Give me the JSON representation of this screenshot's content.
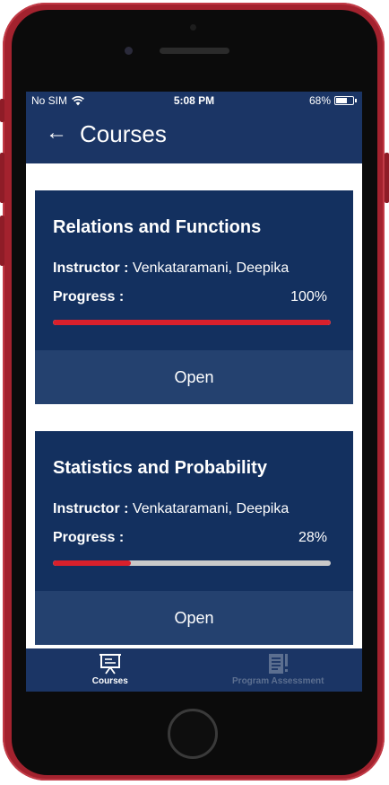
{
  "status_bar": {
    "carrier": "No SIM",
    "time": "5:08 PM",
    "battery": "68%",
    "battery_level": 0.68
  },
  "header": {
    "title": "Courses"
  },
  "courses": [
    {
      "title": "Relations and Functions",
      "instructor_label": "Instructor :",
      "instructor": "Venkataramani, Deepika",
      "progress_label": "Progress :",
      "progress_text": "100%",
      "progress": 1.0,
      "open_label": "Open"
    },
    {
      "title": "Statistics and Probability",
      "instructor_label": "Instructor :",
      "instructor": "Venkataramani, Deepika",
      "progress_label": "Progress :",
      "progress_text": "28%",
      "progress": 0.28,
      "open_label": "Open"
    }
  ],
  "tabs": [
    {
      "label": "Courses",
      "icon": "presentation-board-icon",
      "active": true
    },
    {
      "label": "Program Assessment",
      "icon": "assessment-document-icon",
      "active": false
    }
  ],
  "colors": {
    "primary": "#1b3565",
    "card": "#13305f",
    "accent": "#d8202c",
    "phone_frame": "#a3222e"
  }
}
